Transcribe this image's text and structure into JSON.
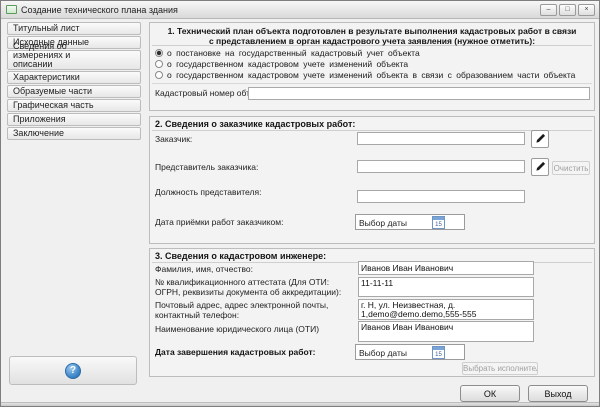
{
  "window": {
    "title": "Создание технического плана здания"
  },
  "icons": {
    "minimize": "–",
    "maximize": "□",
    "close": "×",
    "help": "?",
    "calendar_day": "15"
  },
  "colors": {
    "help_button_blue": "#3c85c7",
    "calendar_icon_blue": "#6f95c5",
    "window_background": "#f0f0f0"
  },
  "sidebar": {
    "items": [
      {
        "label": "Титульный лист"
      },
      {
        "label": "Исходные данные"
      },
      {
        "label": "Сведения об измерениях и описании местоположения"
      },
      {
        "label": "Характеристики"
      },
      {
        "label": "Образуемые части"
      },
      {
        "label": "Графическая часть"
      },
      {
        "label": "Приложения"
      },
      {
        "label": "Заключение"
      }
    ]
  },
  "section1": {
    "title": "1. Технический план объекта подготовлен в результате выполнения кадастровых работ в связи с представлением в орган кадастрового учета заявления (нужное отметить):",
    "options": [
      {
        "label": "о постановке на государственный кадастровый учет объекта",
        "selected": true
      },
      {
        "label": "о государственном кадастровом учете изменений объекта",
        "selected": false
      },
      {
        "label": "о государственном кадастровом учете изменений объекта в связи с образованием части объекта",
        "selected": false
      }
    ],
    "cadastral_number_label": "Кадастровый номер объекта:",
    "cadastral_number_value": ""
  },
  "section2": {
    "title": "2. Сведения о заказчике кадастровых работ:",
    "customer_label": "Заказчик:",
    "customer_value": "",
    "representative_label": "Представитель заказчика:",
    "representative_value": "",
    "clear_button_label": "Очистить",
    "position_label": "Должность представителя:",
    "position_value": "",
    "acceptance_date_label": "Дата приёмки работ заказчиком:",
    "acceptance_date_placeholder": "Выбор даты"
  },
  "section3": {
    "title": "3. Сведения о кадастровом инженере:",
    "rows": [
      {
        "label": "Фамилия, имя, отчество:",
        "value": "Иванов Иван Иванович"
      },
      {
        "label": "№ квалификационного аттестата (Для ОТИ: ОГРН, реквизиты документа об аккредитации):",
        "value": "11-11-11"
      },
      {
        "label": "Почтовый адрес, адрес электронной почты, контактный телефон:",
        "value": "г. Н, ул. Неизвестная, д. 1,demo@demo.demo,555-555"
      },
      {
        "label": "Наименование юридического лица (ОТИ)",
        "value": "Иванов Иван Иванович"
      }
    ],
    "completion_date_label": "Дата завершения кадастровых работ:",
    "completion_date_placeholder": "Выбор даты",
    "select_executor_button_label": "Выбрать исполнителя"
  },
  "footer": {
    "ok_button_label": "ОК",
    "exit_button_label": "Выход"
  }
}
